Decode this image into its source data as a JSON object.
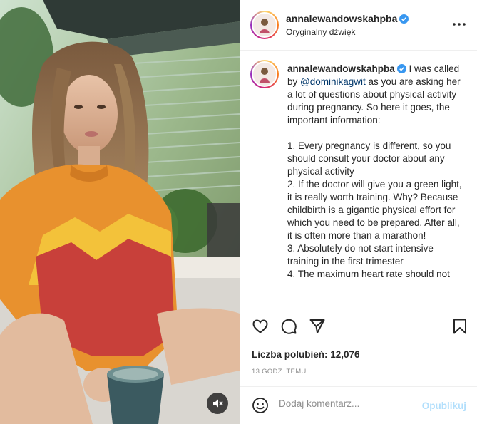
{
  "post": {
    "username": "annalewandowskahpba",
    "audio": "Oryginalny dźwięk",
    "more_icon": "more-dots-icon",
    "mute_icon": "speaker-muted-icon"
  },
  "caption": {
    "username": "annalewandowskahpba",
    "text_a": " I was called by ",
    "mention": "@dominikagwit",
    "lines": [
      " as you are asking her a lot of questions about physical activity during pregnancy. So here it goes, the important information:",
      "",
      "1. Every pregnancy is different, so you should consult your doctor about any physical activity",
      "2. If the doctor will give you a green light, it is really worth training. Why? Because childbirth is a gigantic physical effort for which you need to be prepared. After all, it is often more than a marathon!",
      "3. Absolutely do not start intensive training in the first trimester",
      "4. The maximum heart rate should not"
    ]
  },
  "actions": {
    "like_icon": "heart-icon",
    "comment_icon": "comment-icon",
    "share_icon": "share-icon",
    "save_icon": "bookmark-icon"
  },
  "likes": "Liczba polubień: 12,076",
  "time": "13 GODZ. TEMU",
  "comment": {
    "placeholder": "Dodaj komentarz...",
    "publish": "Opublikuj",
    "emoji_icon": "emoji-icon"
  },
  "colors": {
    "verified": "#3897f0",
    "mention": "#00376b",
    "publish_disabled": "#b2dffc",
    "sweater_orange": "#e8912e",
    "sweater_red": "#c8403a",
    "sweater_yellow": "#f3c23a"
  }
}
